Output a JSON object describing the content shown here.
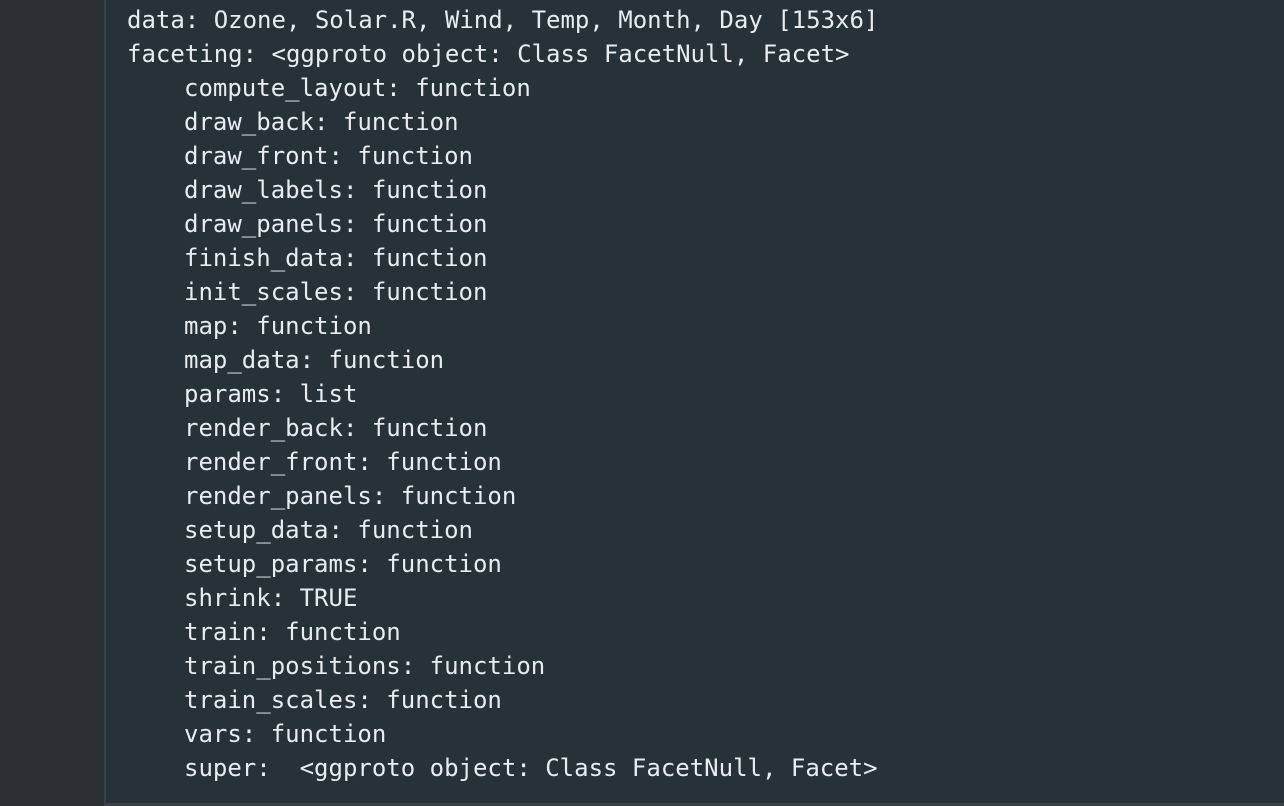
{
  "console": {
    "lines": [
      {
        "text": "data: Ozone, Solar.R, Wind, Temp, Month, Day [153x6]",
        "indent": false
      },
      {
        "text": "faceting: <ggproto object: Class FacetNull, Facet>",
        "indent": false
      },
      {
        "text": "compute_layout: function",
        "indent": true
      },
      {
        "text": "draw_back: function",
        "indent": true
      },
      {
        "text": "draw_front: function",
        "indent": true
      },
      {
        "text": "draw_labels: function",
        "indent": true
      },
      {
        "text": "draw_panels: function",
        "indent": true
      },
      {
        "text": "finish_data: function",
        "indent": true
      },
      {
        "text": "init_scales: function",
        "indent": true
      },
      {
        "text": "map: function",
        "indent": true
      },
      {
        "text": "map_data: function",
        "indent": true
      },
      {
        "text": "params: list",
        "indent": true
      },
      {
        "text": "render_back: function",
        "indent": true
      },
      {
        "text": "render_front: function",
        "indent": true
      },
      {
        "text": "render_panels: function",
        "indent": true
      },
      {
        "text": "setup_data: function",
        "indent": true
      },
      {
        "text": "setup_params: function",
        "indent": true
      },
      {
        "text": "shrink: TRUE",
        "indent": true
      },
      {
        "text": "train: function",
        "indent": true
      },
      {
        "text": "train_positions: function",
        "indent": true
      },
      {
        "text": "train_scales: function",
        "indent": true
      },
      {
        "text": "vars: function",
        "indent": true
      },
      {
        "text": "super:  <ggproto object: Class FacetNull, Facet>",
        "indent": true
      }
    ]
  },
  "colors": {
    "background": "#263238",
    "gutter": "#2b3035",
    "text": "#e8ecef"
  }
}
